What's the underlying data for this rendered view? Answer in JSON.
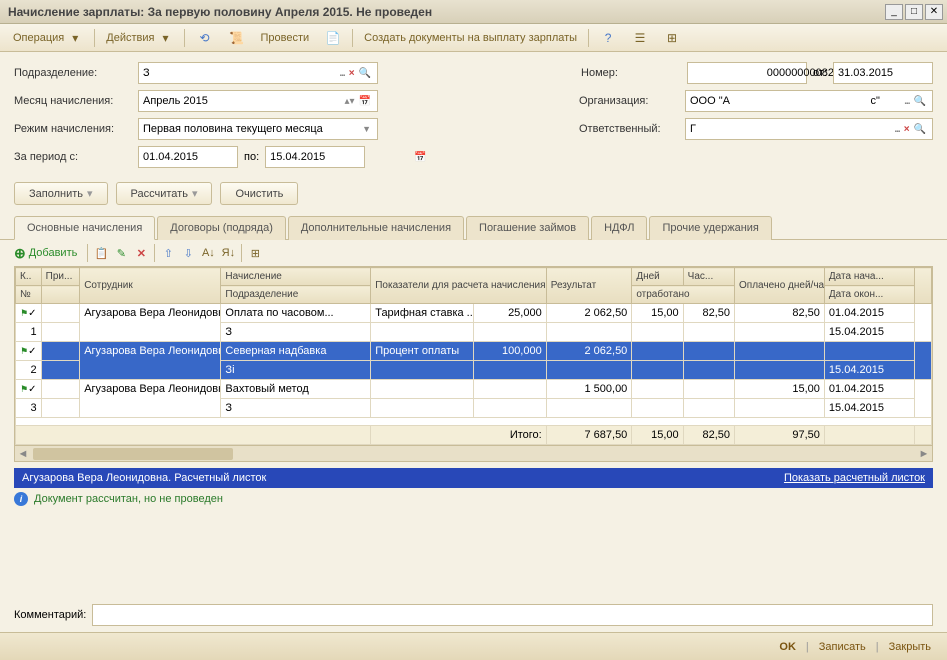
{
  "window": {
    "title": "Начисление зарплаты: За первую половину Апреля 2015. Не проведен"
  },
  "toolbar": {
    "operation": "Операция",
    "actions": "Действия",
    "post": "Провести",
    "create_payout": "Создать документы на выплату зарплаты"
  },
  "form": {
    "subdivision_label": "Подразделение:",
    "subdivision_value": "З",
    "month_label": "Месяц начисления:",
    "month_value": "Апрель 2015",
    "mode_label": "Режим начисления:",
    "mode_value": "Первая половина текущего месяца",
    "period_label": "За период с:",
    "period_from": "01.04.2015",
    "period_to_label": "по:",
    "period_to": "15.04.2015",
    "number_label": "Номер:",
    "number_value": "00000000082",
    "date_label": "от:",
    "date_value": "31.03.2015",
    "org_label": "Организация:",
    "org_value": "ООО \"А                                              с\"",
    "resp_label": "Ответственный:",
    "resp_value": "Г"
  },
  "actions": {
    "fill": "Заполнить",
    "calc": "Рассчитать",
    "clear": "Очистить"
  },
  "tabs": [
    "Основные начисления",
    "Договоры (подряда)",
    "Дополнительные начисления",
    "Погашение займов",
    "НДФЛ",
    "Прочие удержания"
  ],
  "tabToolbar": {
    "add": "Добавить"
  },
  "grid": {
    "headers": {
      "k": "К..",
      "pri": "При...",
      "employee": "Сотрудник",
      "accrual": "Начисление",
      "subdivision": "Подразделение",
      "indicators": "Показатели для расчета начисления",
      "result": "Результат",
      "days": "Дней",
      "hours": "Час...",
      "worked": "отработано",
      "paid": "Оплачено дней/часов",
      "date_start": "Дата нача...",
      "date_end": "Дата окон...",
      "num": "№"
    },
    "rows": [
      {
        "n": "1",
        "emp": "Агузарова Вера Леонидовна",
        "accr": "Оплата по часовом...",
        "sub": "З",
        "ind_name": "Тарифная ставка ...",
        "ind_val": "25,000",
        "res": "2 062,50",
        "days": "15,00",
        "hours": "82,50",
        "paid": "82,50",
        "d1": "01.04.2015",
        "d2": "15.04.2015"
      },
      {
        "n": "2",
        "emp": "Агузарова Вера Леонидовна",
        "accr": "Северная надбавка",
        "sub": "Зі",
        "ind_name": "Процент оплаты",
        "ind_val": "100,000",
        "res": "2 062,50",
        "days": "",
        "hours": "",
        "paid": "",
        "d1": "",
        "d2": "15.04.2015",
        "selected": true
      },
      {
        "n": "3",
        "emp": "Агузарова Вера Леонидовна",
        "accr": "Вахтовый метод",
        "sub": "З",
        "ind_name": "",
        "ind_val": "",
        "res": "1 500,00",
        "days": "",
        "hours": "",
        "paid": "15,00",
        "d1": "01.04.2015",
        "d2": "15.04.2015"
      }
    ],
    "totals": {
      "label": "Итого:",
      "res": "7 687,50",
      "days": "15,00",
      "hours": "82,50",
      "paid": "97,50"
    }
  },
  "infoBar": {
    "left": "Агузарова Вера Леонидовна. Расчетный листок",
    "right": "Показать расчетный листок"
  },
  "docStatus": "Документ рассчитан, но не проведен",
  "comment": {
    "label": "Комментарий:",
    "value": ""
  },
  "bottom": {
    "ok": "OK",
    "save": "Записать",
    "close": "Закрыть"
  }
}
